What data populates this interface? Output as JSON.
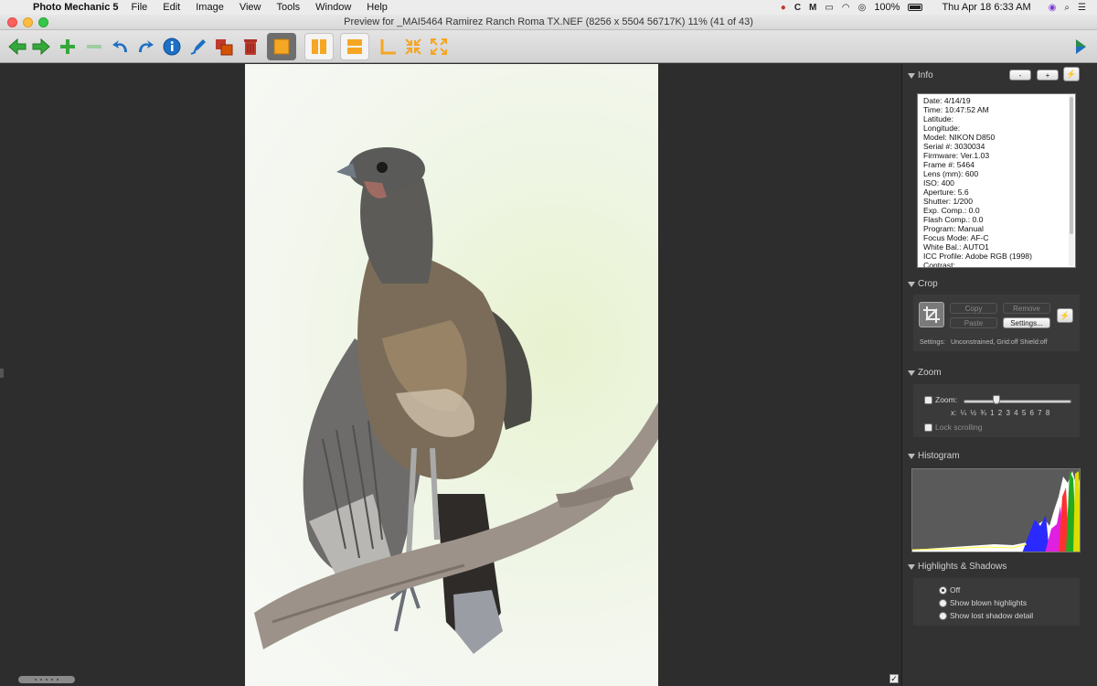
{
  "menubar": {
    "app_name": "Photo Mechanic 5",
    "menus": [
      "File",
      "Edit",
      "Image",
      "View",
      "Tools",
      "Window",
      "Help"
    ],
    "battery": "100%",
    "datetime": "Thu Apr 18  6:33 AM"
  },
  "window": {
    "title": "Preview for _MAI5464 Ramirez Ranch Roma TX.NEF (8256 x 5504 56717K) 11% (41 of 43)"
  },
  "toolbar": {
    "colors": {
      "green": "#35a83b",
      "blue": "#1e6fc4",
      "orange": "#f5a623",
      "red": "#c0392b"
    }
  },
  "info": {
    "header": "Info",
    "minus_label": "-",
    "plus_label": "+",
    "lines": [
      "Date: 4/14/19",
      "Time: 10:47:52 AM",
      "Latitude:",
      "Longitude:",
      "Model: NIKON D850",
      "Serial #: 3030034",
      "Firmware: Ver.1.03",
      "Frame #: 5464",
      "Lens (mm): 600",
      "ISO: 400",
      "Aperture: 5.6",
      "Shutter: 1/200",
      "Exp. Comp.: 0.0",
      "Flash Comp.: 0.0",
      "Program: Manual",
      "Focus Mode: AF-C",
      "White Bal.: AUTO1",
      "ICC Profile: Adobe RGB (1998)",
      "Contrast:"
    ]
  },
  "crop": {
    "header": "Crop",
    "copy": "Copy",
    "paste": "Paste",
    "remove": "Remove",
    "settings_button": "Settings...",
    "settings_label": "Settings:",
    "settings_value": "Unconstrained, Grid:off Shield:off"
  },
  "zoom": {
    "header": "Zoom",
    "zoom_label": "Zoom:",
    "ticks": "x:  ¼  ½  ¾  1  2  3  4  5  6  7  8",
    "lock_label": "Lock scrolling"
  },
  "histogram": {
    "header": "Histogram"
  },
  "highlights": {
    "header": "Highlights & Shadows",
    "options": [
      "Off",
      "Show blown highlights",
      "Show lost shadow detail"
    ],
    "selected": "Off"
  },
  "corner_check": "✓"
}
